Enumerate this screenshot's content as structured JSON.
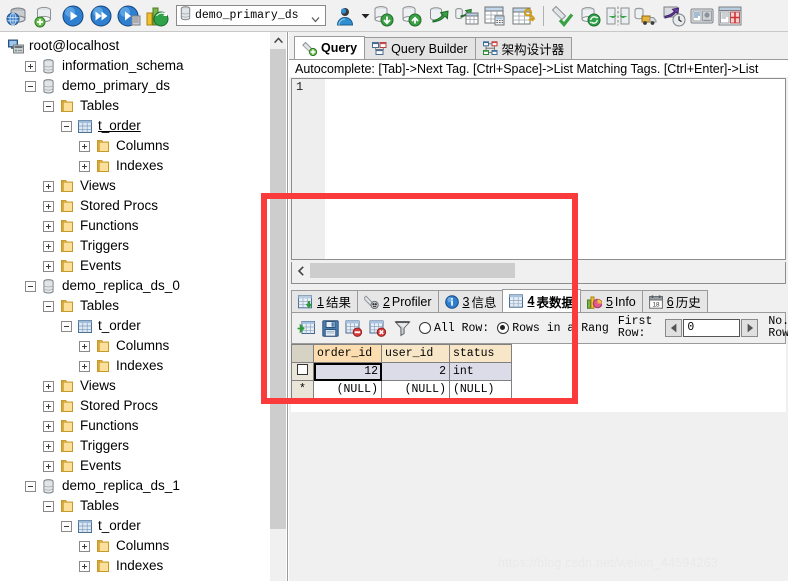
{
  "toolbar": {
    "icons": [
      {
        "name": "connection-manager-icon",
        "title": "Connection Manager"
      },
      {
        "name": "new-connection-icon",
        "title": "New Connection"
      },
      {
        "name": "execute-icon",
        "title": "Execute"
      },
      {
        "name": "execute-all-icon",
        "title": "Execute All"
      },
      {
        "name": "stop-execute-icon",
        "title": "Stop"
      },
      {
        "name": "explain-plan-icon",
        "title": "Explain Plan"
      }
    ],
    "db_selector": {
      "value": "demo_primary_ds",
      "icon": "database-cylinder-icon",
      "chevron": "chevron-down-icon"
    },
    "icons_right": [
      {
        "name": "user-manager-icon",
        "title": "User Manager"
      },
      {
        "name": "dropdown-caret-icon",
        "title": "More"
      },
      {
        "name": "import-database-icon",
        "title": "Import Database"
      },
      {
        "name": "export-database-icon",
        "title": "Export Database"
      },
      {
        "name": "backup-restore-icon",
        "title": "Backup / Restore"
      },
      {
        "name": "database-to-table-icon",
        "title": "Database To Table"
      },
      {
        "name": "table-data-icon",
        "title": "Table Data"
      },
      {
        "name": "table-key-icon",
        "title": "Table Keys"
      },
      {
        "name": "paint-check-icon",
        "title": "Validate"
      },
      {
        "name": "db-refresh-icon",
        "title": "Refresh Database"
      },
      {
        "name": "compare-sync-icon",
        "title": "Compare / Sync"
      },
      {
        "name": "data-transfer-icon",
        "title": "Data Transfer"
      },
      {
        "name": "scheduler-icon",
        "title": "Scheduler"
      },
      {
        "name": "report-designer-icon",
        "title": "Report Designer"
      },
      {
        "name": "form-designer-icon",
        "title": "Form Designer"
      }
    ]
  },
  "tree": {
    "root": {
      "label": "root@localhost",
      "icon": "server-icon"
    },
    "nodes": [
      {
        "label": "information_schema",
        "icon": "database-icon",
        "indent": 1,
        "expander": "plus"
      },
      {
        "label": "demo_primary_ds",
        "icon": "database-icon",
        "indent": 1,
        "expander": "minus"
      },
      {
        "label": "Tables",
        "icon": "folder-icon",
        "indent": 2,
        "expander": "minus"
      },
      {
        "label": "t_order",
        "icon": "table-icon",
        "indent": 3,
        "expander": "minus",
        "underline": true
      },
      {
        "label": "Columns",
        "icon": "folder-icon",
        "indent": 4,
        "expander": "plus"
      },
      {
        "label": "Indexes",
        "icon": "folder-icon",
        "indent": 4,
        "expander": "plus"
      },
      {
        "label": "Views",
        "icon": "folder-icon",
        "indent": 2,
        "expander": "plus"
      },
      {
        "label": "Stored Procs",
        "icon": "folder-icon",
        "indent": 2,
        "expander": "plus"
      },
      {
        "label": "Functions",
        "icon": "folder-icon",
        "indent": 2,
        "expander": "plus"
      },
      {
        "label": "Triggers",
        "icon": "folder-icon",
        "indent": 2,
        "expander": "plus"
      },
      {
        "label": "Events",
        "icon": "folder-icon",
        "indent": 2,
        "expander": "plus"
      },
      {
        "label": "demo_replica_ds_0",
        "icon": "database-icon",
        "indent": 1,
        "expander": "minus"
      },
      {
        "label": "Tables",
        "icon": "folder-icon",
        "indent": 2,
        "expander": "minus"
      },
      {
        "label": "t_order",
        "icon": "table-icon",
        "indent": 3,
        "expander": "minus"
      },
      {
        "label": "Columns",
        "icon": "folder-icon",
        "indent": 4,
        "expander": "plus"
      },
      {
        "label": "Indexes",
        "icon": "folder-icon",
        "indent": 4,
        "expander": "plus"
      },
      {
        "label": "Views",
        "icon": "folder-icon",
        "indent": 2,
        "expander": "plus"
      },
      {
        "label": "Stored Procs",
        "icon": "folder-icon",
        "indent": 2,
        "expander": "plus"
      },
      {
        "label": "Functions",
        "icon": "folder-icon",
        "indent": 2,
        "expander": "plus"
      },
      {
        "label": "Triggers",
        "icon": "folder-icon",
        "indent": 2,
        "expander": "plus"
      },
      {
        "label": "Events",
        "icon": "folder-icon",
        "indent": 2,
        "expander": "plus"
      },
      {
        "label": "demo_replica_ds_1",
        "icon": "database-icon",
        "indent": 1,
        "expander": "minus"
      },
      {
        "label": "Tables",
        "icon": "folder-icon",
        "indent": 2,
        "expander": "minus"
      },
      {
        "label": "t_order",
        "icon": "table-icon",
        "indent": 3,
        "expander": "minus"
      },
      {
        "label": "Columns",
        "icon": "folder-icon",
        "indent": 4,
        "expander": "plus"
      },
      {
        "label": "Indexes",
        "icon": "folder-icon",
        "indent": 4,
        "expander": "plus"
      }
    ]
  },
  "top_tabs": [
    {
      "label": "Query",
      "icon": "query-icon",
      "active": true
    },
    {
      "label": "Query Builder",
      "icon": "query-builder-icon",
      "active": false
    },
    {
      "label": "架构设计器",
      "icon": "schema-designer-icon",
      "active": false
    }
  ],
  "editor": {
    "autocomplete_hint": "Autocomplete: [Tab]->Next Tag. [Ctrl+Space]->List Matching Tags. [Ctrl+Enter]->List",
    "line_number": "1",
    "content": "",
    "hscroll_left_icon": "chevron-left-icon"
  },
  "result_tabs": [
    {
      "num": "1",
      "label": "结果",
      "icon": "results-grid-icon",
      "active": false
    },
    {
      "num": "2",
      "label": "Profiler",
      "icon": "profiler-icon",
      "active": false
    },
    {
      "num": "3",
      "label": "信息",
      "icon": "info-circle-icon",
      "active": false
    },
    {
      "num": "4",
      "label": "表数据",
      "icon": "table-data-icon",
      "active": true
    },
    {
      "num": "5",
      "label": "Info",
      "icon": "chart-icon",
      "active": false
    },
    {
      "num": "6",
      "label": "历史",
      "icon": "calendar-icon",
      "active": false
    }
  ],
  "grid_toolbar": {
    "icons": [
      {
        "name": "add-row-icon",
        "title": "Add Row"
      },
      {
        "name": "save-row-icon",
        "title": "Save Row"
      },
      {
        "name": "delete-row-icon",
        "title": "Delete Row"
      },
      {
        "name": "cancel-edit-icon",
        "title": "Cancel Edit"
      },
      {
        "name": "filter-icon",
        "title": "Filter"
      }
    ],
    "radio_all_rows": {
      "label": "All Row:",
      "selected": false
    },
    "radio_range": {
      "label": "Rows in a Rang",
      "selected": true
    },
    "first_row_label": "First\nRow:",
    "first_row_label_l1": "First",
    "first_row_label_l2": "Row:",
    "first_row_value": "0",
    "spin_down_icon": "spin-left-icon",
    "spin_up_icon": "spin-right-icon",
    "no_of_rows_l1": "No. of",
    "no_of_rows_l2": "Rows:"
  },
  "data_grid": {
    "columns": [
      "order_id",
      "user_id",
      "status"
    ],
    "selected_column": "order_id",
    "rows": [
      {
        "marker": "checkbox",
        "cells": [
          "12",
          "2",
          "int"
        ],
        "current": true
      },
      {
        "marker": "*",
        "cells": [
          "(NULL)",
          "(NULL)",
          "(NULL)"
        ],
        "current": false
      }
    ]
  },
  "annotation": {
    "type": "red-rectangle-highlight",
    "color": "#fb3b3b"
  },
  "watermark": {
    "text": "https://blog.csdn.net/weixin_44594263"
  }
}
